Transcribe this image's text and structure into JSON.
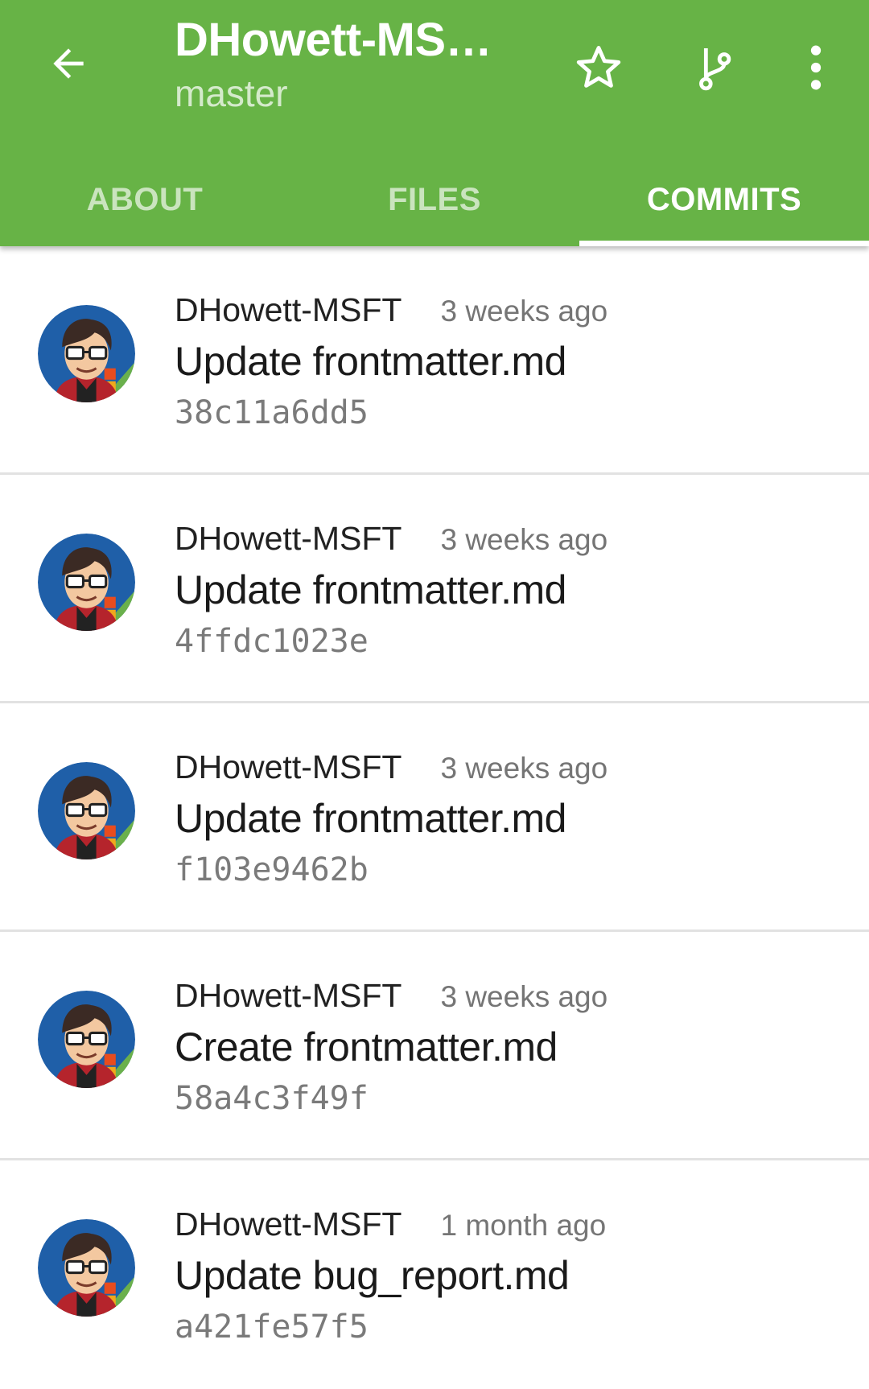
{
  "header": {
    "back_icon": "arrow-back-icon",
    "repo_title": "DHowett-MSF…",
    "branch": "master",
    "star_icon": "star-outline-icon",
    "branch_icon": "git-branch-icon",
    "more_icon": "more-vertical-icon",
    "color": "#67b346"
  },
  "tabs": [
    {
      "label": "ABOUT",
      "active": false
    },
    {
      "label": "FILES",
      "active": false
    },
    {
      "label": "COMMITS",
      "active": true
    }
  ],
  "commits": [
    {
      "author": "DHowett-MSFT",
      "time": "3 weeks ago",
      "message": "Update frontmatter.md",
      "sha": "38c11a6dd5"
    },
    {
      "author": "DHowett-MSFT",
      "time": "3 weeks ago",
      "message": "Update frontmatter.md",
      "sha": "4ffdc1023e"
    },
    {
      "author": "DHowett-MSFT",
      "time": "3 weeks ago",
      "message": "Update frontmatter.md",
      "sha": "f103e9462b"
    },
    {
      "author": "DHowett-MSFT",
      "time": "3 weeks ago",
      "message": "Create frontmatter.md",
      "sha": "58a4c3f49f"
    },
    {
      "author": "DHowett-MSFT",
      "time": "1 month ago",
      "message": "Update bug_report.md",
      "sha": "a421fe57f5"
    }
  ]
}
